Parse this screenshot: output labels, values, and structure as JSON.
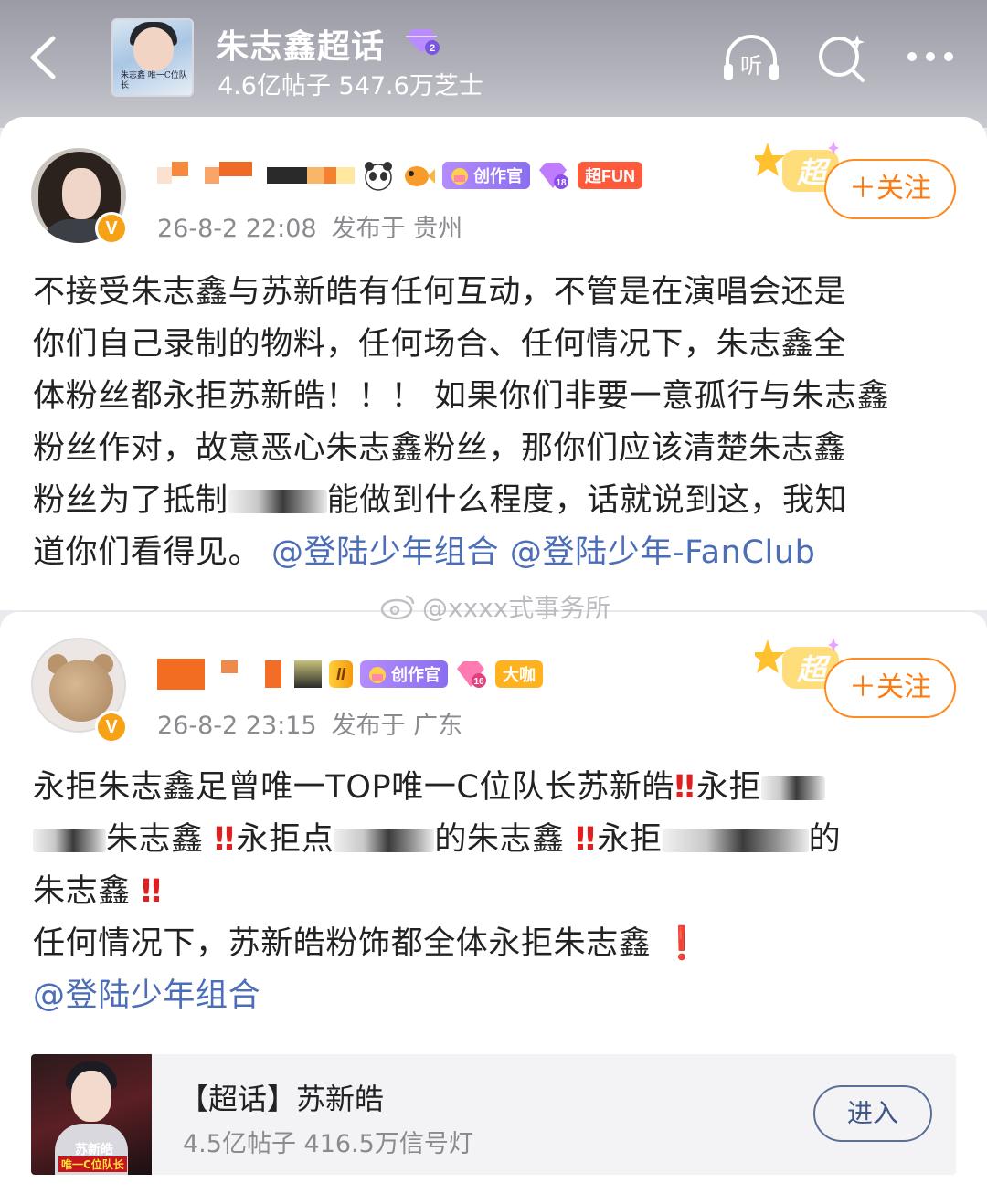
{
  "header": {
    "topic_title": "朱志鑫超话",
    "topic_level": "2",
    "topic_stats": "4.6亿帖子 547.6万芝士",
    "listen_label": "听",
    "thumb_caption": "朱志鑫 唯一C位队长",
    "icons": [
      "back-icon",
      "listen-icon",
      "search-icon",
      "more-icon"
    ]
  },
  "posts": [
    {
      "badges": {
        "creator": "创作官",
        "level": "18",
        "fun": "超FUN"
      },
      "time": "26-8-2 22:08",
      "location": "发布于 贵州",
      "verified": "V",
      "super_label": "超",
      "follow": "＋关注",
      "lines": [
        "不接受朱志鑫与苏新皓有任何互动，不管是在演唱会还是",
        "你们自己录制的物料，任何场合、任何情况下，朱志鑫全",
        "体粉丝都永拒苏新皓！！！ 如果你们非要一意孤行与朱志鑫",
        "粉丝作对，故意恶心朱志鑫粉丝，那你们应该清楚朱志鑫"
      ],
      "line5_a": "粉丝为了抵制",
      "line5_b": "能做到什么程度，话就说到这，我知",
      "line6_a": "道你们看得见。",
      "mention1": "@登陆少年组合",
      "mention2": "@登陆少年-FanClub"
    },
    {
      "badges": {
        "lv": "II",
        "creator": "创作官",
        "level": "16",
        "kaka": "大咖"
      },
      "time": "26-8-2 23:15",
      "location": "发布于 广东",
      "verified": "V",
      "super_label": "超",
      "follow": "＋关注",
      "l1_a": "永拒朱志鑫足曾唯一TOP唯一C位队长苏新皓",
      "l1_b": "永拒",
      "l2_a": "朱志鑫",
      "l2_b": "永拒点",
      "l2_c": "的朱志鑫",
      "l2_d": "永拒",
      "l2_e": "的",
      "l3_a": "朱志鑫",
      "l4_a": "任何情况下，苏新皓粉饰都全体永拒朱志鑫",
      "double_mark": "‼",
      "single_mark": "❗",
      "mention1": "@登陆少年组合"
    }
  ],
  "watermark": "@xxxx式事务所",
  "topic_card": {
    "title": "【超话】苏新皓",
    "stats": "4.5亿帖子 416.5万信号灯",
    "enter": "进入",
    "thumb_name": "苏新皓",
    "thumb_sub": "唯一C位队长"
  },
  "colors": {
    "accent_orange": "#ff7a0f",
    "mention_blue": "#4c6db7",
    "alert_red": "#e02020"
  }
}
